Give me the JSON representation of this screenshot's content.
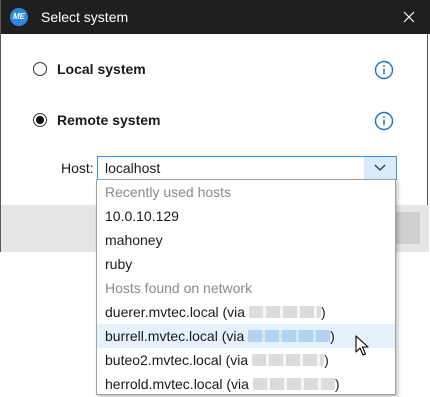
{
  "window": {
    "title": "Select system",
    "app_icon_text": "ME"
  },
  "options": {
    "local_label": "Local system",
    "remote_label": "Remote system",
    "selected": "remote"
  },
  "host": {
    "label": "Host:",
    "value": "localhost"
  },
  "dropdown": {
    "recent_header": "Recently used hosts",
    "recent": [
      "10.0.10.129",
      "mahoney",
      "ruby"
    ],
    "network_header": "Hosts found on network",
    "network": [
      {
        "name": "duerer.mvtec.local (via",
        "suffix": ")"
      },
      {
        "name": "burrell.mvtec.local (via",
        "suffix": ")"
      },
      {
        "name": "buteo2.mvtec.local (via",
        "suffix": ")"
      },
      {
        "name": "herrold.mvtec.local (via",
        "suffix": ")"
      }
    ],
    "hovered_item": "burrell.mvtec.local"
  },
  "colors": {
    "titlebar": "#1f1f1f",
    "accent": "#2e86de",
    "hover": "#e5f1fb",
    "info_icon": "#1a73c8"
  },
  "icons": [
    "close-icon",
    "info-icon",
    "chevron-down-icon",
    "mouse-pointer-icon"
  ]
}
